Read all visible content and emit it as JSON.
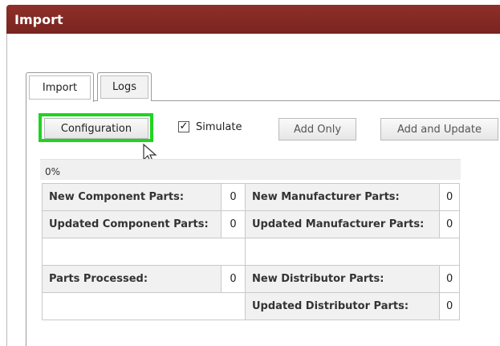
{
  "window": {
    "title": "Import"
  },
  "tabs": [
    {
      "label": "Import",
      "active": true
    },
    {
      "label": "Logs",
      "active": false
    }
  ],
  "toolbar": {
    "configuration_label": "Configuration",
    "simulate_label": "Simulate",
    "simulate_checked": true,
    "check_mark": "✓",
    "add_only_label": "Add Only",
    "add_update_label": "Add and Update"
  },
  "progress": {
    "text": "0%"
  },
  "stats": {
    "new_component_parts": {
      "label": "New Component Parts:",
      "value": "0"
    },
    "updated_component_parts": {
      "label": "Updated Component Parts:",
      "value": "0"
    },
    "parts_processed": {
      "label": "Parts Processed:",
      "value": "0"
    },
    "new_manufacturer_parts": {
      "label": "New Manufacturer Parts:",
      "value": "0"
    },
    "updated_manufacturer_parts": {
      "label": "Updated Manufacturer Parts:",
      "value": "0"
    },
    "new_distributor_parts": {
      "label": "New Distributor Parts:",
      "value": "0"
    },
    "updated_distributor_parts": {
      "label": "Updated Distributor Parts:",
      "value": "0"
    }
  },
  "colors": {
    "titlebar": "#7a2420",
    "highlight": "#21d321"
  }
}
